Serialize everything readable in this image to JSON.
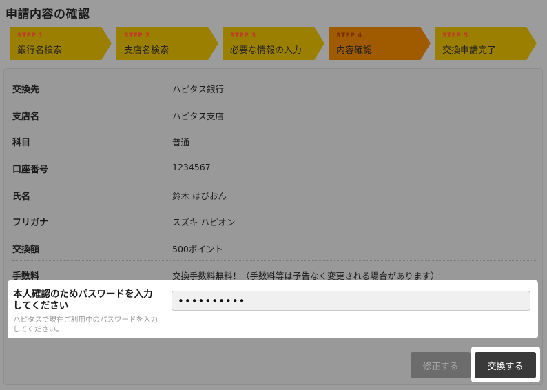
{
  "page": {
    "title": "申請内容の確認"
  },
  "steps": [
    {
      "num": "STEP 1",
      "label": "銀行名検索"
    },
    {
      "num": "STEP 2",
      "label": "支店名検索"
    },
    {
      "num": "STEP 3",
      "label": "必要な情報の入力"
    },
    {
      "num": "STEP 4",
      "label": "内容確認",
      "active": true
    },
    {
      "num": "STEP 5",
      "label": "交換申請完了"
    }
  ],
  "details": [
    {
      "key": "交換先",
      "value": "ハピタス銀行"
    },
    {
      "key": "支店名",
      "value": "ハピタス支店"
    },
    {
      "key": "科目",
      "value": "普通"
    },
    {
      "key": "口座番号",
      "value": "1234567"
    },
    {
      "key": "氏名",
      "value": "鈴木 はぴおん"
    },
    {
      "key": "フリガナ",
      "value": "スズキ ハピオン"
    },
    {
      "key": "交換額",
      "value": "500ポイント"
    },
    {
      "key": "手数料",
      "value": "交換手数料無料！（手数料等は予告なく変更される場合があります）"
    }
  ],
  "password": {
    "label": "本人確認のためパスワードを入力してください",
    "hint": "ハピタスで現在ご利用中のパスワードを入力してください。",
    "value": "••••••••••"
  },
  "buttons": {
    "edit": "修正する",
    "exchange": "交換する"
  },
  "colors": {
    "step_bg": "#9a7f00",
    "step_active_bg": "#a05a00",
    "step_num": "#c0392b",
    "primary_button": "#3a3a3a"
  }
}
